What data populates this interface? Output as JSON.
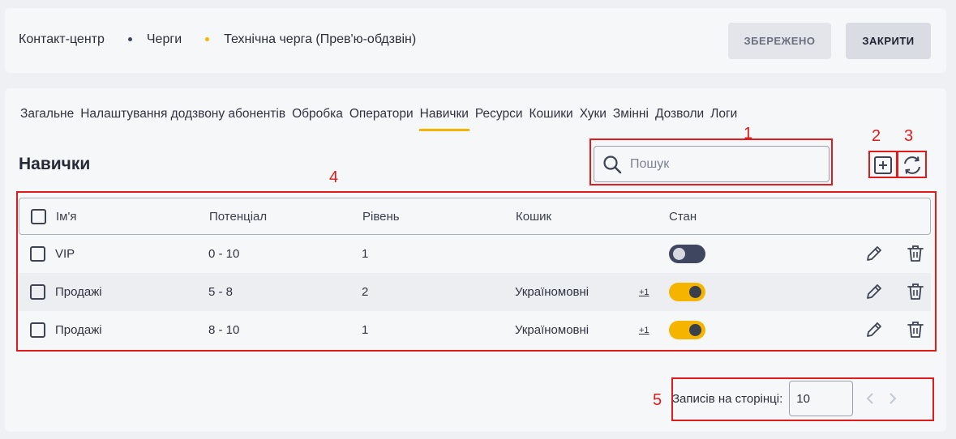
{
  "breadcrumb": [
    "Контакт-центр",
    "Черги",
    "Технічна черга (Прев'ю-обдзвін)"
  ],
  "buttons": {
    "saved": "ЗБЕРЕЖЕНО",
    "close": "ЗАКРИТИ"
  },
  "tabs": [
    {
      "label": "Загальне",
      "active": false
    },
    {
      "label": "Налаштування додзвону абонентів",
      "active": false
    },
    {
      "label": "Обробка",
      "active": false
    },
    {
      "label": "Оператори",
      "active": false
    },
    {
      "label": "Навички",
      "active": true
    },
    {
      "label": "Ресурси",
      "active": false
    },
    {
      "label": "Кошики",
      "active": false
    },
    {
      "label": "Хуки",
      "active": false
    },
    {
      "label": "Змінні",
      "active": false
    },
    {
      "label": "Дозволи",
      "active": false
    },
    {
      "label": "Логи",
      "active": false
    }
  ],
  "section_title": "Навички",
  "search": {
    "placeholder": "Пошук",
    "value": ""
  },
  "table": {
    "headers": {
      "name": "Ім'я",
      "potential": "Потенціал",
      "level": "Рівень",
      "basket": "Кошик",
      "state": "Стан"
    },
    "rows": [
      {
        "name": "VIP",
        "potential": "0 - 10",
        "level": "1",
        "basket": "",
        "more": "",
        "enabled": false
      },
      {
        "name": "Продажі",
        "potential": "5 - 8",
        "level": "2",
        "basket": "Україномовні",
        "more": "+1",
        "enabled": true
      },
      {
        "name": "Продажі",
        "potential": "8 - 10",
        "level": "1",
        "basket": "Україномовні",
        "more": "+1",
        "enabled": true
      }
    ]
  },
  "pagination": {
    "label": "Записів на сторінці:",
    "per_page": "10"
  },
  "annotations": [
    "1",
    "2",
    "3",
    "4",
    "5"
  ],
  "colors": {
    "accent": "#f5b400",
    "toggle_off": "#3e4660",
    "annotation": "#e01b1b"
  }
}
